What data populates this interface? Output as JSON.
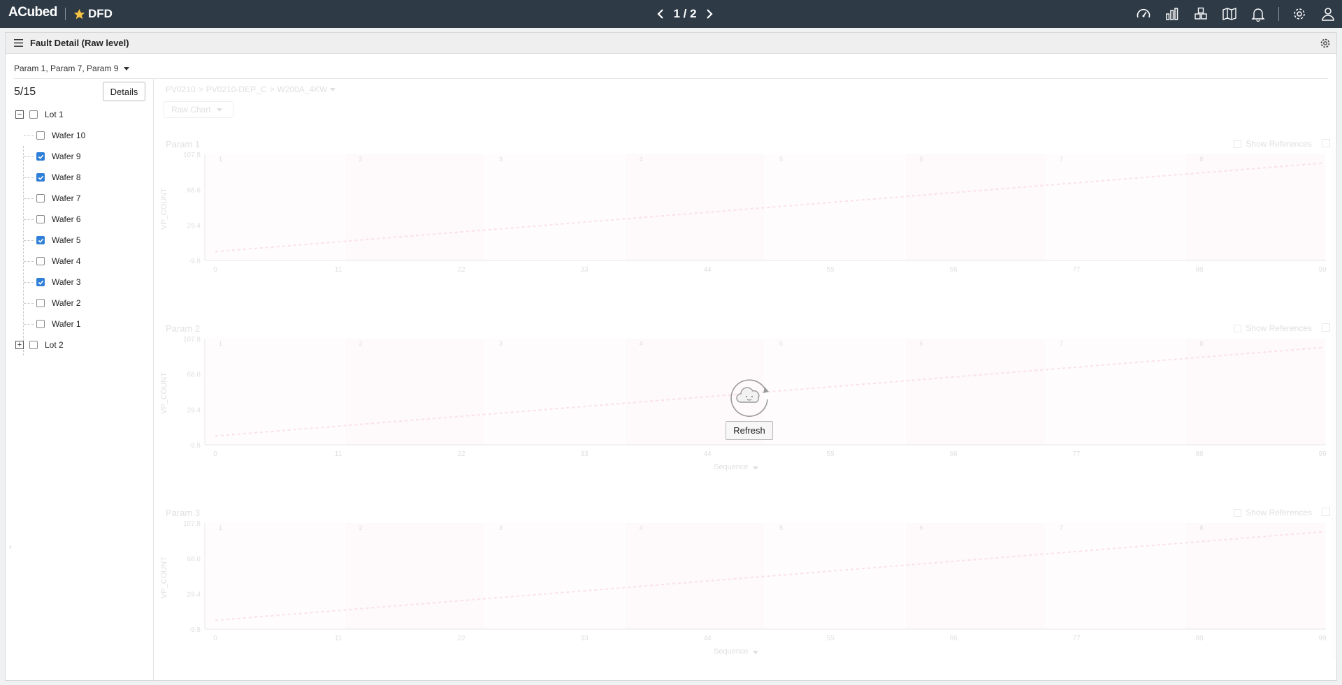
{
  "topbar": {
    "brand": "ACubed",
    "app_name": "DFD",
    "page_indicator": "1 / 2"
  },
  "panel": {
    "title": "Fault Detail (Raw level)",
    "param_selector": "Param 1, Param 7, Param 9"
  },
  "sidebar": {
    "count": "5/15",
    "details_label": "Details",
    "lots": [
      {
        "label": "Lot 1",
        "expanded": true,
        "checked": false,
        "wafers": [
          {
            "label": "Wafer 10",
            "checked": false
          },
          {
            "label": "Wafer 9",
            "checked": true
          },
          {
            "label": "Wafer 8",
            "checked": true
          },
          {
            "label": "Wafer 7",
            "checked": false
          },
          {
            "label": "Wafer 6",
            "checked": false
          },
          {
            "label": "Wafer 5",
            "checked": true
          },
          {
            "label": "Wafer 4",
            "checked": false
          },
          {
            "label": "Wafer 3",
            "checked": true
          },
          {
            "label": "Wafer 2",
            "checked": false
          },
          {
            "label": "Wafer 1",
            "checked": false
          }
        ]
      },
      {
        "label": "Lot 2",
        "expanded": false,
        "checked": false,
        "wafers": []
      }
    ]
  },
  "main": {
    "breadcrumb": [
      "PV0210",
      "PV0210-DEP_C",
      "W200A_4KW"
    ],
    "chart_type_label": "Raw Chart",
    "show_references_label": "Show References",
    "sequence_label": "Sequence",
    "refresh_label": "Refresh"
  },
  "chart_data": [
    {
      "type": "line",
      "title": "Param 1",
      "ylabel": "VP_COUNT",
      "yticks": [
        "107.8",
        "68.6",
        "29.4",
        "-9.8"
      ],
      "xticks": [
        "0",
        "11",
        "22",
        "33",
        "44",
        "55",
        "66",
        "77",
        "88",
        "99"
      ],
      "xlim": [
        0,
        99
      ],
      "ylim": [
        -9.8,
        107.8
      ],
      "step_bands": [
        "1",
        "2",
        "3",
        "4",
        "5",
        "6",
        "7",
        "8"
      ],
      "series": [
        {
          "x": [
            0,
            99
          ],
          "y": [
            0,
            98
          ]
        }
      ],
      "sequence_label_shown": false
    },
    {
      "type": "line",
      "title": "Param 2",
      "ylabel": "VP_COUNT",
      "yticks": [
        "107.8",
        "68.6",
        "29.4",
        "-9.8"
      ],
      "xticks": [
        "0",
        "11",
        "22",
        "33",
        "44",
        "55",
        "66",
        "77",
        "88",
        "99"
      ],
      "xlim": [
        0,
        99
      ],
      "ylim": [
        -9.8,
        107.8
      ],
      "step_bands": [
        "1",
        "2",
        "3",
        "4",
        "5",
        "6",
        "7",
        "8"
      ],
      "series": [
        {
          "x": [
            0,
            99
          ],
          "y": [
            0,
            98
          ]
        }
      ],
      "sequence_label_shown": true
    },
    {
      "type": "line",
      "title": "Param 3",
      "ylabel": "VP_COUNT",
      "yticks": [
        "107.8",
        "68.6",
        "29.4",
        "-9.8"
      ],
      "xticks": [
        "0",
        "11",
        "22",
        "33",
        "44",
        "55",
        "66",
        "77",
        "88",
        "99"
      ],
      "xlim": [
        0,
        99
      ],
      "ylim": [
        -9.8,
        107.8
      ],
      "step_bands": [
        "1",
        "2",
        "3",
        "4",
        "5",
        "6",
        "7",
        "8"
      ],
      "series": [
        {
          "x": [
            0,
            99
          ],
          "y": [
            0,
            98
          ]
        }
      ],
      "sequence_label_shown": true
    }
  ]
}
